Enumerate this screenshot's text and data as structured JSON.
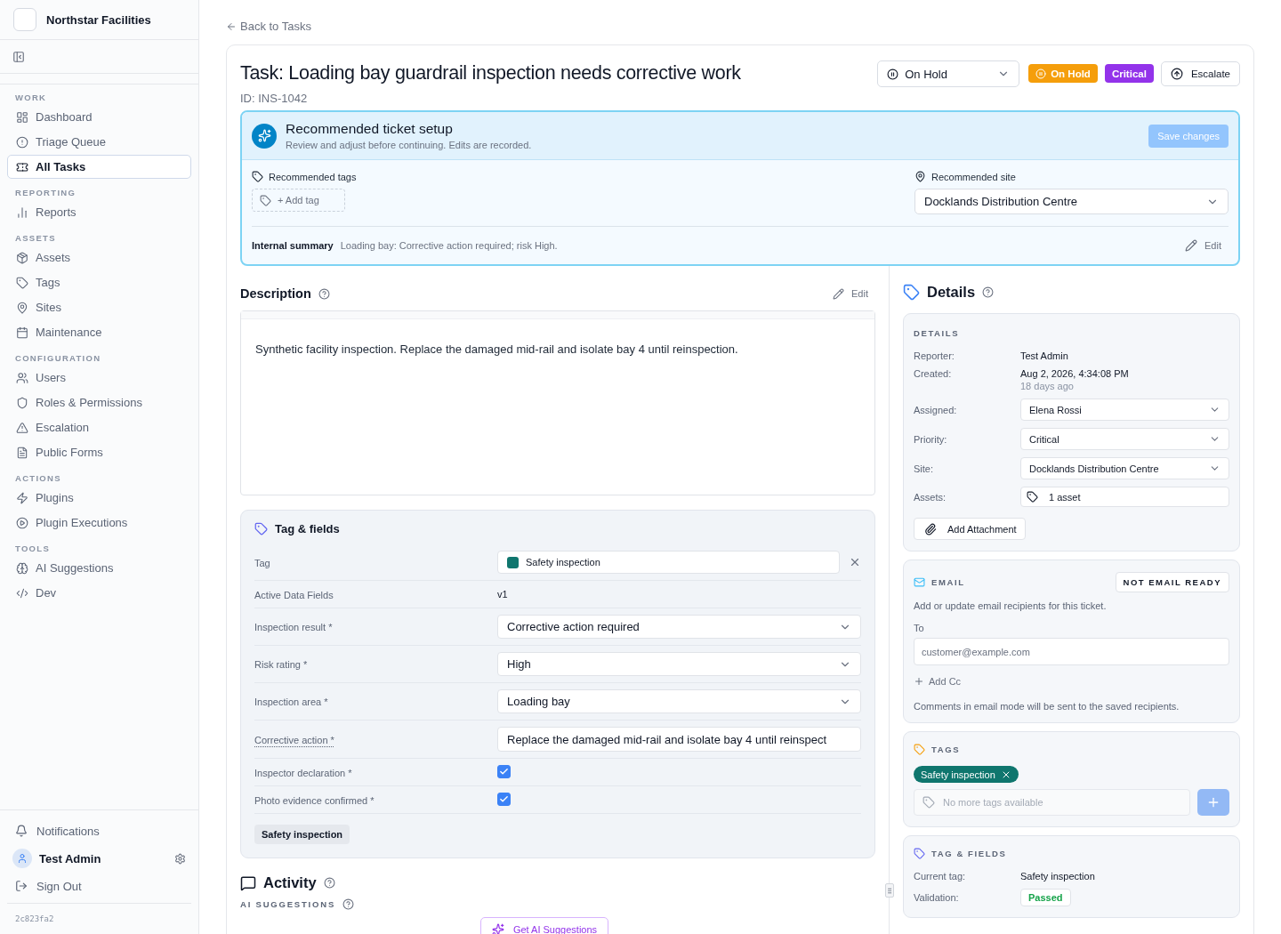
{
  "sidebar": {
    "brand": "Northstar Facilities",
    "sections": [
      {
        "title": "WORK",
        "items": [
          {
            "label": "Dashboard",
            "selected": false
          },
          {
            "label": "Triage Queue",
            "selected": false
          },
          {
            "label": "All Tasks",
            "selected": true
          }
        ]
      },
      {
        "title": "REPORTING",
        "items": [
          {
            "label": "Reports",
            "selected": false
          }
        ]
      },
      {
        "title": "ASSETS",
        "items": [
          {
            "label": "Assets",
            "selected": false
          },
          {
            "label": "Tags",
            "selected": false
          },
          {
            "label": "Sites",
            "selected": false
          },
          {
            "label": "Maintenance",
            "selected": false
          }
        ]
      },
      {
        "title": "CONFIGURATION",
        "items": [
          {
            "label": "Users",
            "selected": false
          },
          {
            "label": "Roles & Permissions",
            "selected": false
          },
          {
            "label": "Escalation",
            "selected": false
          },
          {
            "label": "Public Forms",
            "selected": false
          }
        ]
      },
      {
        "title": "ACTIONS",
        "items": [
          {
            "label": "Plugins",
            "selected": false
          },
          {
            "label": "Plugin Executions",
            "selected": false
          }
        ]
      },
      {
        "title": "TOOLS",
        "items": [
          {
            "label": "AI Suggestions",
            "selected": false
          },
          {
            "label": "Dev",
            "selected": false
          }
        ]
      }
    ],
    "notifications": "Notifications",
    "user": "Test Admin",
    "sign_out": "Sign Out",
    "version": "2c823fa2"
  },
  "back_link": "Back to Tasks",
  "task": {
    "title": "Task: Loading bay guardrail inspection needs corrective work",
    "id": "ID: INS-1042",
    "status_select": "On Hold",
    "status_badge": "On Hold",
    "priority_badge": "Critical",
    "escalate": "Escalate"
  },
  "recommendation": {
    "title": "Recommended ticket setup",
    "subtitle": "Review and adjust before continuing. Edits are recorded.",
    "save": "Save changes",
    "save_disabled": true,
    "tags_label": "Recommended tags",
    "add_tag": "+ Add tag",
    "site_label": "Recommended site",
    "site": "Docklands Distribution Centre",
    "summary_label": "Internal summary",
    "summary": "Loading bay: Corrective action required; risk High.",
    "edit": "Edit"
  },
  "description": {
    "title": "Description",
    "edit": "Edit",
    "text": "Synthetic facility inspection. Replace the damaged mid-rail and isolate bay 4 until reinspection."
  },
  "tag_fields": {
    "title": "Tag & fields",
    "rows": [
      {
        "kind": "tag",
        "label": "Tag",
        "value": "Safety inspection",
        "color": "#0f766e"
      },
      {
        "kind": "text",
        "label": "Active Data Fields",
        "value": "v1"
      },
      {
        "kind": "select",
        "label": "Inspection result *",
        "value": "Corrective action required"
      },
      {
        "kind": "select",
        "label": "Risk rating *",
        "value": "High"
      },
      {
        "kind": "select",
        "label": "Inspection area *",
        "value": "Loading bay"
      },
      {
        "kind": "input",
        "label": "Corrective action *",
        "value": "Replace the damaged mid-rail and isolate bay 4 until reinspect"
      },
      {
        "kind": "checkbox",
        "label": "Inspector declaration *",
        "checked": true
      },
      {
        "kind": "checkbox",
        "label": "Photo evidence confirmed *",
        "checked": true
      }
    ],
    "chip": "Safety inspection"
  },
  "activity": {
    "title": "Activity",
    "ai_label": "AI SUGGESTIONS",
    "ai_button": "Get AI Suggestions"
  },
  "details": {
    "title": "Details",
    "section": "DETAILS",
    "rows": [
      {
        "kind": "text",
        "label": "Reporter:",
        "value": "Test Admin"
      },
      {
        "kind": "date",
        "label": "Created:",
        "value": "Aug 2, 2026, 4:34:08 PM",
        "sub": "18 days ago"
      },
      {
        "kind": "select",
        "label": "Assigned:",
        "value": "Elena Rossi"
      },
      {
        "kind": "select",
        "label": "Priority:",
        "value": "Critical"
      },
      {
        "kind": "select",
        "label": "Site:",
        "value": "Docklands Distribution Centre"
      },
      {
        "kind": "assets",
        "label": "Assets:",
        "value": "1 asset"
      }
    ],
    "add_attachment": "Add Attachment"
  },
  "email": {
    "label": "EMAIL",
    "badge": "NOT EMAIL READY",
    "hint": "Add or update email recipients for this ticket.",
    "to_label": "To",
    "to_placeholder": "customer@example.com",
    "add_cc": "Add Cc",
    "footnote": "Comments in email mode will be sent to the saved recipients."
  },
  "tags": {
    "label": "TAGS",
    "items": [
      {
        "label": "Safety inspection",
        "color": "#0f766e"
      }
    ],
    "placeholder": "No more tags available",
    "add_disabled": true
  },
  "tag_summary": {
    "label": "TAG & FIELDS",
    "current_label": "Current tag:",
    "current": "Safety inspection",
    "validation_label": "Validation:",
    "validation": "Passed"
  }
}
